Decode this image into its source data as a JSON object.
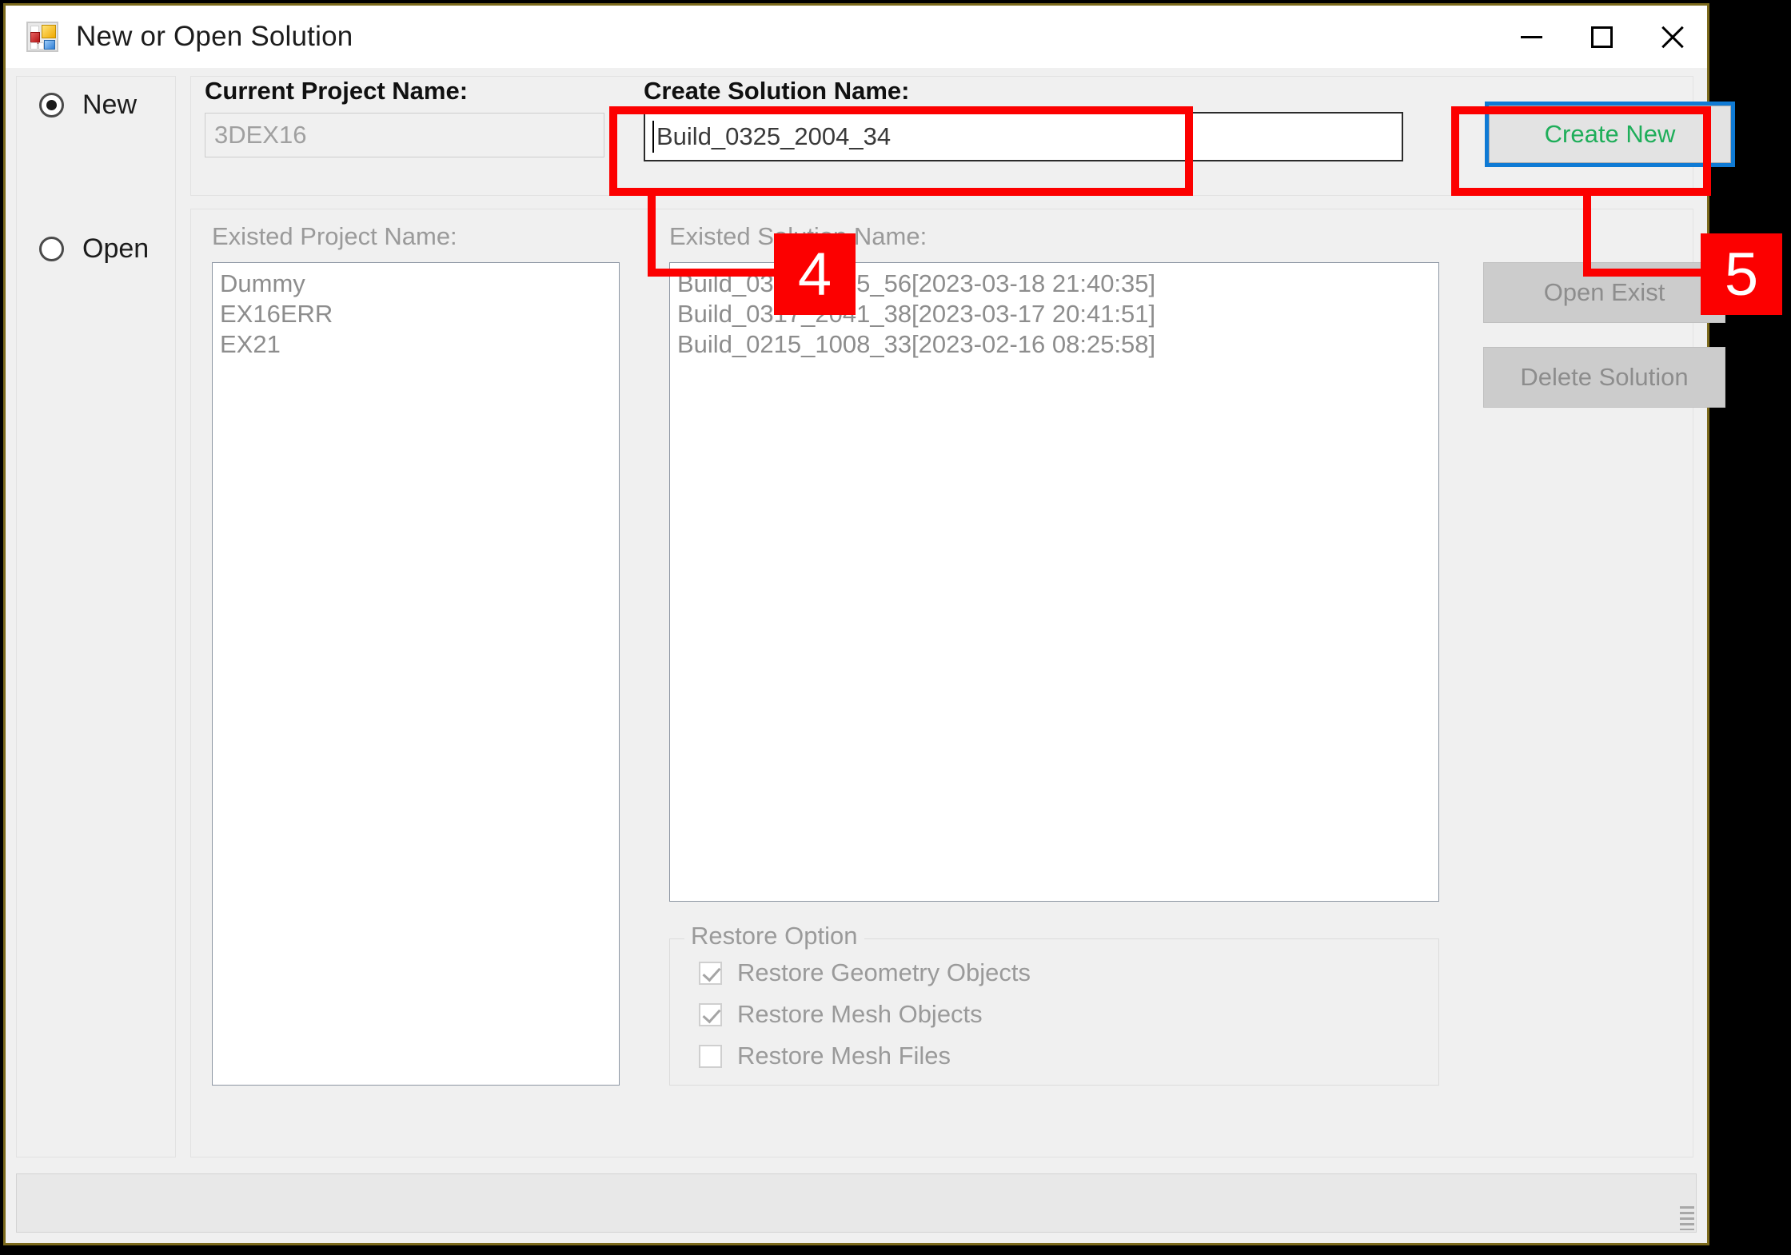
{
  "window": {
    "title": "New or Open Solution",
    "icon": "form-designer-icon",
    "controls": {
      "minimize": "minimize-icon",
      "maximize": "maximize-icon",
      "close": "close-icon"
    }
  },
  "mode": {
    "new_label": "New",
    "new_selected": true,
    "open_label": "Open",
    "open_selected": false
  },
  "top_panel": {
    "current_project_label": "Current Project Name:",
    "current_project_value": "3DEX16",
    "create_solution_label": "Create Solution Name:",
    "create_solution_value": "Build_0325_2004_34",
    "create_new_button": "Create New"
  },
  "bottom_panel": {
    "existed_project_label": "Existed Project Name:",
    "existed_projects": [
      "Dummy",
      "EX16ERR",
      "EX21"
    ],
    "existed_solution_label": "Existed Solution Name:",
    "existed_solutions": [
      "Build_0318_2135_56[2023-03-18 21:40:35]",
      "Build_0317_2041_38[2023-03-17 20:41:51]",
      "Build_0215_1008_33[2023-02-16 08:25:58]"
    ],
    "open_exist_button": "Open Exist",
    "delete_solution_button": "Delete Solution"
  },
  "restore_option": {
    "title": "Restore Option",
    "items": [
      {
        "label": "Restore Geometry Objects",
        "checked": true
      },
      {
        "label": "Restore Mesh Objects",
        "checked": true
      },
      {
        "label": "Restore Mesh Files",
        "checked": false
      }
    ]
  },
  "status_bar": {
    "text": ""
  },
  "annotations": {
    "badge_4": "4",
    "badge_5": "5",
    "color": "#fc0000"
  },
  "colors": {
    "window_border": "#7c6a1c",
    "surface": "#f0f0f0",
    "focus_blue": "#0f7ad4",
    "create_new_text": "#1fae5a",
    "disabled_text": "#9a9a9a",
    "annotation_red": "#fc0000"
  }
}
